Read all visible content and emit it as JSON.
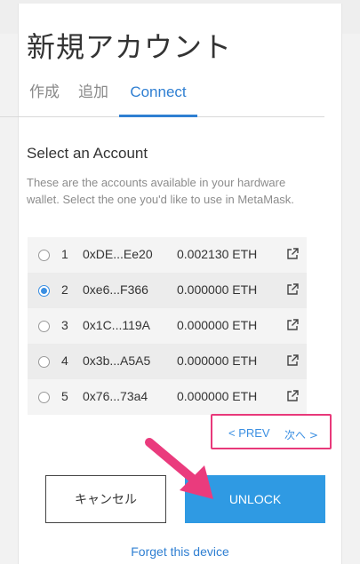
{
  "page": {
    "title": "新規アカウント"
  },
  "tabs": [
    {
      "label": "作成"
    },
    {
      "label": "追加"
    },
    {
      "label": "Connect",
      "active": true
    }
  ],
  "section": {
    "title": "Select an Account",
    "description": "These are the accounts available in your hardware wallet. Select the one you'd like to use in MetaMask."
  },
  "accounts": [
    {
      "index": "1",
      "address": "0xDE...Ee20",
      "balance": "0.002130 ETH",
      "selected": false
    },
    {
      "index": "2",
      "address": "0xe6...F366",
      "balance": "0.000000 ETH",
      "selected": true
    },
    {
      "index": "3",
      "address": "0x1C...119A",
      "balance": "0.000000 ETH",
      "selected": false
    },
    {
      "index": "4",
      "address": "0x3b...A5A5",
      "balance": "0.000000 ETH",
      "selected": false
    },
    {
      "index": "5",
      "address": "0x76...73a4",
      "balance": "0.000000 ETH",
      "selected": false
    }
  ],
  "pagination": {
    "prev_label": "< PREV",
    "next_label": "次へ >"
  },
  "buttons": {
    "cancel_label": "キャンセル",
    "unlock_label": "UNLOCK"
  },
  "footer": {
    "forget_label": "Forget this device"
  },
  "colors": {
    "accent": "#2f7fd2",
    "unlock_bg": "#2f9ae3",
    "highlight": "#e8397a"
  },
  "icons": {
    "external_link": "external-link-icon",
    "annotation_arrow": "annotation-arrow-icon"
  }
}
